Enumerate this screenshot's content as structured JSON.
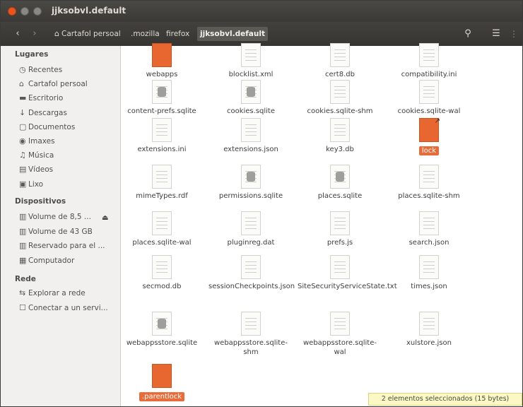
{
  "window": {
    "title": "jjksobvl.default"
  },
  "toolbar": {
    "back_icon": "‹",
    "forward_icon": "›",
    "search_icon": "search-icon",
    "list_icon": "menu-icon",
    "grid_icon": "grid-icon"
  },
  "breadcrumbs": [
    {
      "label": "Cartafol persoal"
    },
    {
      "label": ".mozilla"
    },
    {
      "label": "firefox"
    },
    {
      "label": "jjksobvl.default"
    }
  ],
  "sidebar": {
    "places_header": "Lugares",
    "places": [
      {
        "label": "Recentes",
        "icon": "clock-icon"
      },
      {
        "label": "Cartafol persoal",
        "icon": "home-icon"
      },
      {
        "label": "Escritorio",
        "icon": "desktop-icon"
      },
      {
        "label": "Descargas",
        "icon": "download-icon"
      },
      {
        "label": "Documentos",
        "icon": "document-icon"
      },
      {
        "label": "Imaxes",
        "icon": "camera-icon"
      },
      {
        "label": "Música",
        "icon": "music-icon"
      },
      {
        "label": "Vídeos",
        "icon": "film-icon"
      },
      {
        "label": "Lixo",
        "icon": "trash-icon"
      }
    ],
    "devices_header": "Dispositivos",
    "devices": [
      {
        "label": "Volume de 8,5 ...",
        "icon": "drive-icon"
      },
      {
        "label": "Volume de 43 GB",
        "icon": "drive-icon"
      },
      {
        "label": "Reservado para el ...",
        "icon": "drive-icon"
      },
      {
        "label": "Computador",
        "icon": "computer-icon"
      }
    ],
    "network_header": "Rede",
    "network": [
      {
        "label": "Explorar a rede",
        "icon": "network-icon"
      },
      {
        "label": "Conectar a un servi...",
        "icon": "server-icon"
      }
    ]
  },
  "files": [
    {
      "name": "webapps",
      "kind": "folder"
    },
    {
      "name": "blocklist.xml",
      "kind": "doc"
    },
    {
      "name": "cert8.db",
      "kind": "doc"
    },
    {
      "name": "compatibility.ini",
      "kind": "doc"
    },
    {
      "name": "content-prefs.sqlite",
      "kind": "db"
    },
    {
      "name": "cookies.sqlite",
      "kind": "db"
    },
    {
      "name": "cookies.sqlite-shm",
      "kind": "doc"
    },
    {
      "name": "cookies.sqlite-wal",
      "kind": "doc"
    },
    {
      "name": "extensions.ini",
      "kind": "doc"
    },
    {
      "name": "extensions.json",
      "kind": "doc"
    },
    {
      "name": "key3.db",
      "kind": "doc"
    },
    {
      "name": "lock",
      "kind": "link",
      "selected": true
    },
    {
      "name": "mimeTypes.rdf",
      "kind": "doc"
    },
    {
      "name": "permissions.sqlite",
      "kind": "db"
    },
    {
      "name": "places.sqlite",
      "kind": "db"
    },
    {
      "name": "places.sqlite-shm",
      "kind": "doc"
    },
    {
      "name": "places.sqlite-wal",
      "kind": "doc"
    },
    {
      "name": "pluginreg.dat",
      "kind": "doc"
    },
    {
      "name": "prefs.js",
      "kind": "doc"
    },
    {
      "name": "search.json",
      "kind": "doc"
    },
    {
      "name": "secmod.db",
      "kind": "doc"
    },
    {
      "name": "sessionCheckpoints.json",
      "kind": "doc"
    },
    {
      "name": "SiteSecurityServiceState.txt",
      "kind": "doc"
    },
    {
      "name": "times.json",
      "kind": "doc"
    },
    {
      "name": "webappsstore.sqlite",
      "kind": "db"
    },
    {
      "name": "webappsstore.sqlite-shm",
      "kind": "doc"
    },
    {
      "name": "webappsstore.sqlite-wal",
      "kind": "doc"
    },
    {
      "name": "xulstore.json",
      "kind": "doc"
    },
    {
      "name": ".parentlock",
      "kind": "orange",
      "selected": true
    }
  ],
  "status": "2 elementos seleccionados (15 bytes)",
  "colors": {
    "accent": "#e86c3a",
    "titlebar": "#3c3b37",
    "sidebar": "#f1f0ee"
  }
}
